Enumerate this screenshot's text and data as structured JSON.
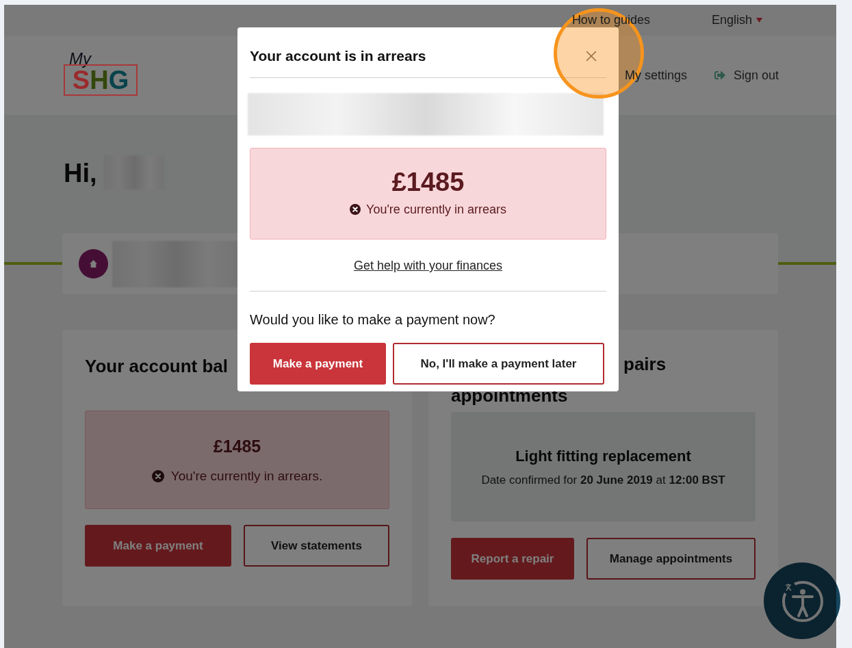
{
  "top_nav": {
    "guides": "How to guides",
    "language": "English"
  },
  "header": {
    "logo": {
      "top": "My",
      "letters": [
        {
          "text": "S",
          "color": "#9a2a2c"
        },
        {
          "text": "H",
          "color": "#33480b"
        },
        {
          "text": "G",
          "color": "#09434d"
        }
      ]
    },
    "links": [
      {
        "label": "My settings",
        "kind": "plain"
      },
      {
        "label": "Sign out",
        "kind": "signout"
      }
    ]
  },
  "greeting": "Hi,",
  "account_card": {
    "heading": "Your account bal",
    "amount": "£1485",
    "status": "You're currently in arrears.",
    "buttons": [
      {
        "label": "Make a payment",
        "kind": "primary"
      },
      {
        "label": "View statements",
        "kind": "outline"
      }
    ]
  },
  "repairs_card": {
    "heading_lines": [
      "pairs",
      "appointments"
    ],
    "appointment": {
      "title": "Light fitting replacement",
      "detail": "Date confirmed for **20 June 2019** at **12:00 BST**"
    },
    "buttons": [
      {
        "label": "Report a repair",
        "kind": "primary"
      },
      {
        "label": "Manage appointments",
        "kind": "outline"
      }
    ]
  },
  "modal": {
    "title": "Your account is in arrears",
    "amount": "£1485",
    "status": "You're currently in arrears",
    "help_link": "Get help with your finances",
    "question": "Would you like to make a payment now?",
    "buttons": [
      {
        "label": "Make a payment",
        "kind": "primary"
      },
      {
        "label": "No, I'll make a payment later",
        "kind": "outline"
      }
    ]
  }
}
